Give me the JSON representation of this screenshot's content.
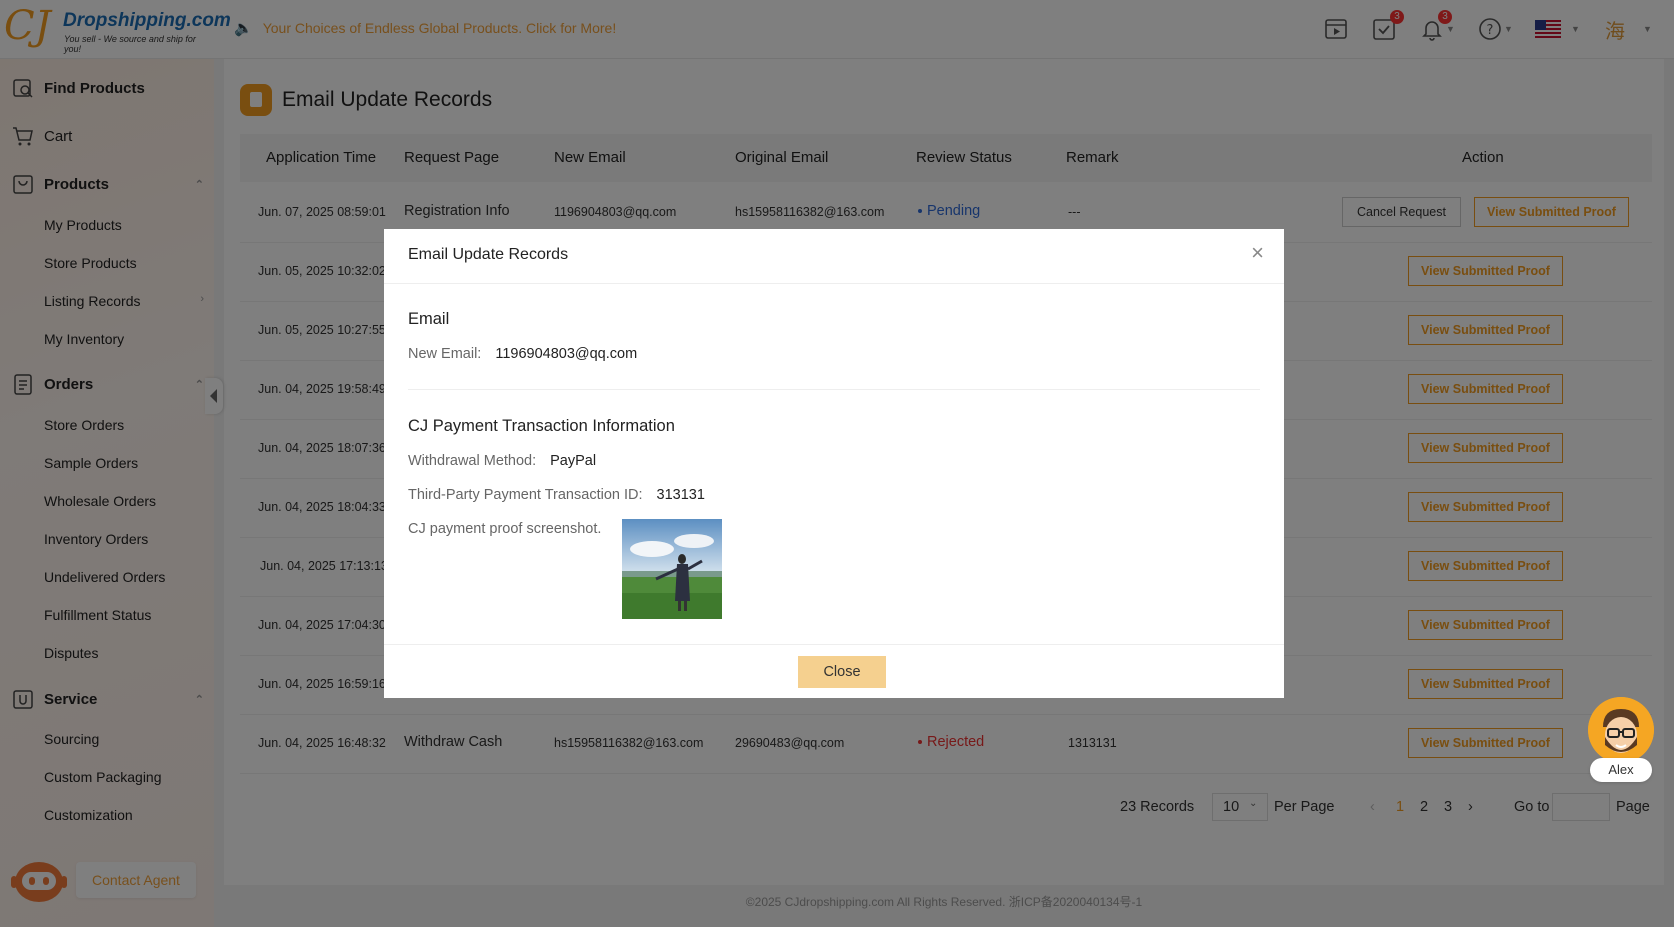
{
  "header": {
    "logo_mark": "CJ",
    "logo_text": "Dropshipping.com",
    "logo_tagline": "You sell - We source and ship for you!",
    "announcement": "Your Choices of Endless Global Products. Click for More!",
    "task_badge": "3",
    "notification_badge": "3",
    "avatar_char": "海"
  },
  "sidebar": {
    "find_products": "Find Products",
    "cart": "Cart",
    "products": "Products",
    "products_items": [
      "My Products",
      "Store Products",
      "Listing Records",
      "My Inventory"
    ],
    "orders": "Orders",
    "orders_items": [
      "Store Orders",
      "Sample Orders",
      "Wholesale Orders",
      "Inventory Orders",
      "Undelivered Orders",
      "Fulfillment Status",
      "Disputes"
    ],
    "service": "Service",
    "service_items": [
      "Sourcing",
      "Custom Packaging",
      "Customization"
    ],
    "contact_agent": "Contact Agent"
  },
  "page": {
    "title": "Email Update Records"
  },
  "table": {
    "headers": {
      "time": "Application Time",
      "request_page": "Request Page",
      "new_email": "New Email",
      "original_email": "Original Email",
      "status": "Review Status",
      "remark": "Remark",
      "action": "Action"
    },
    "rows": [
      {
        "time": "Jun. 07, 2025 08:59:01",
        "request_page": "Registration Info",
        "new_email": "1196904803@qq.com",
        "original_email": "hs15958116382@163.com",
        "status": "Pending",
        "remark": "---",
        "action_cancel": "Cancel Request",
        "action_view": "View Submitted Proof"
      },
      {
        "time": "Jun. 05, 2025 10:32:02",
        "action_view": "View Submitted Proof"
      },
      {
        "time": "Jun. 05, 2025 10:27:55",
        "action_view": "View Submitted Proof"
      },
      {
        "time": "Jun. 04, 2025 19:58:49",
        "action_view": "View Submitted Proof"
      },
      {
        "time": "Jun. 04, 2025 18:07:36",
        "action_view": "View Submitted Proof"
      },
      {
        "time": "Jun. 04, 2025 18:04:33",
        "action_view": "View Submitted Proof"
      },
      {
        "time": "Jun. 04, 2025 17:13:13",
        "action_view": "View Submitted Proof"
      },
      {
        "time": "Jun. 04, 2025 17:04:30",
        "action_view": "View Submitted Proof"
      },
      {
        "time": "Jun. 04, 2025 16:59:16",
        "action_view": "View Submitted Proof"
      },
      {
        "time": "Jun. 04, 2025 16:48:32",
        "request_page": "Withdraw Cash",
        "new_email": "hs15958116382@163.com",
        "original_email": "29690483@qq.com",
        "status": "Rejected",
        "remark": "1313131",
        "action_view": "View Submitted Proof"
      }
    ]
  },
  "pagination": {
    "total": "23 Records",
    "per_page_value": "10",
    "per_page_label": "Per Page",
    "pages": [
      "1",
      "2",
      "3"
    ],
    "current_page": "1",
    "goto_label": "Go to",
    "page_label": "Page"
  },
  "footer": "©2025 CJdropshipping.com All Rights Reserved. 浙ICP备2020040134号-1",
  "modal": {
    "title": "Email Update Records",
    "email_section": "Email",
    "new_email_label": "New Email:",
    "new_email_value": "1196904803@qq.com",
    "payment_section": "CJ Payment Transaction Information",
    "withdrawal_label": "Withdrawal Method:",
    "withdrawal_value": "PayPal",
    "txn_label": "Third-Party Payment Transaction ID:",
    "txn_value": "313131",
    "proof_label": "CJ payment proof screenshot.",
    "close_button": "Close"
  },
  "agent": {
    "name": "Alex"
  },
  "colors": {
    "accent": "#f39c21",
    "pending": "#2f6bd8",
    "rejected": "#e33333"
  }
}
